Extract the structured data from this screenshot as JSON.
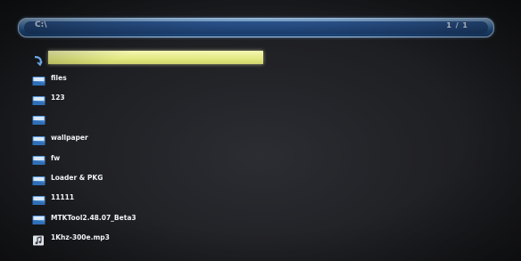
{
  "header": {
    "path": "C:\\",
    "page_indicator": "1 / 1"
  },
  "files": [
    {
      "name": "",
      "type": "parent",
      "icon": "return-arrow-icon",
      "selected": true
    },
    {
      "name": "files",
      "type": "folder",
      "icon": "folder-icon",
      "selected": false
    },
    {
      "name": "123",
      "type": "folder",
      "icon": "folder-icon",
      "selected": false
    },
    {
      "name": "",
      "type": "folder",
      "icon": "folder-icon",
      "selected": false
    },
    {
      "name": "wallpaper",
      "type": "folder",
      "icon": "folder-icon",
      "selected": false
    },
    {
      "name": "fw",
      "type": "folder",
      "icon": "folder-icon",
      "selected": false
    },
    {
      "name": "Loader & PKG",
      "type": "folder",
      "icon": "folder-icon",
      "selected": false
    },
    {
      "name": "11111",
      "type": "folder",
      "icon": "folder-icon",
      "selected": false
    },
    {
      "name": "MTKTool2.48.07_Beta3",
      "type": "folder",
      "icon": "folder-icon",
      "selected": false
    },
    {
      "name": "1Khz-300e.mp3",
      "type": "audio",
      "icon": "music-file-icon",
      "selected": false
    }
  ],
  "colors": {
    "header_blue": "#214f86",
    "highlight_yellow": "#e2e882",
    "background": "#1b1c20"
  }
}
